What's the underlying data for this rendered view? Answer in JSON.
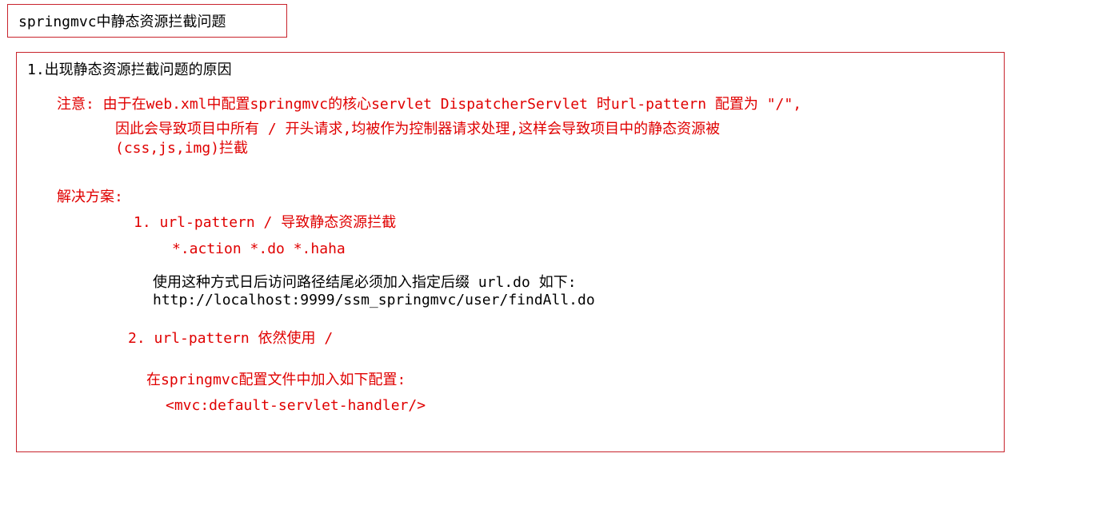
{
  "header": {
    "title": "springmvc中静态资源拦截问题"
  },
  "content": {
    "section_heading": "1.出现静态资源拦截问题的原因",
    "note_line1": "注意: 由于在web.xml中配置springmvc的核心servlet DispatcherServlet 时url-pattern 配置为 \"/\",",
    "note_line2": "因此会导致项目中所有 / 开头请求,均被作为控制器请求处理,这样会导致项目中的静态资源被",
    "note_line3": "(css,js,img)拦截",
    "solution_heading": "解决方案:",
    "option1_title": "1. url-pattern / 导致静态资源拦截",
    "option1_patterns": "*.action *.do *.haha",
    "option1_desc": "使用这种方式日后访问路径结尾必须加入指定后缀  url.do 如下:",
    "option1_example": "http://localhost:9999/ssm_springmvc/user/findAll.do",
    "option2_title": "2. url-pattern 依然使用 /",
    "option2_desc": "在springmvc配置文件中加入如下配置:",
    "option2_config": "<mvc:default-servlet-handler/>"
  },
  "colors": {
    "border": "#c8232c",
    "emphasis": "#e00000",
    "text": "#000000"
  }
}
